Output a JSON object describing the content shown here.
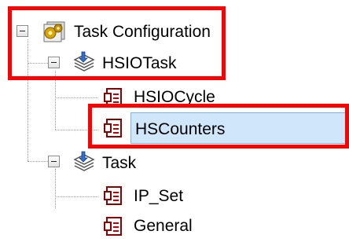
{
  "tree": {
    "root": {
      "label": "Task Configuration",
      "icon": "task-configuration-icon",
      "expanded": true,
      "children": [
        {
          "label": "HSIOTask",
          "icon": "task-stack-icon",
          "expanded": true,
          "children": [
            {
              "label": "HSIOCycle",
              "icon": "program-call-icon"
            },
            {
              "label": "HSCounters",
              "icon": "program-call-icon",
              "selected": true
            }
          ]
        },
        {
          "label": "Task",
          "icon": "task-stack-icon",
          "expanded": true,
          "children": [
            {
              "label": "IP_Set",
              "icon": "program-call-icon"
            },
            {
              "label": "General",
              "icon": "program-call-icon"
            }
          ]
        }
      ]
    }
  },
  "highlight_color": "#ff0000",
  "selection_color": "#cfe6fb"
}
